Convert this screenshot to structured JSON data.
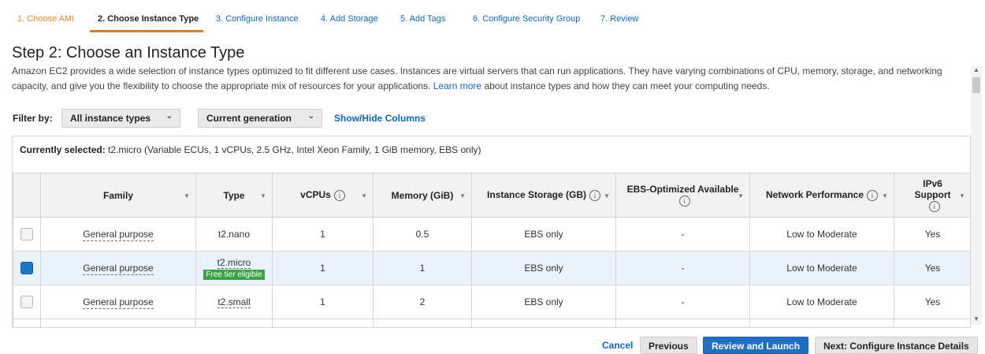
{
  "steps": [
    {
      "label": "1. Choose AMI"
    },
    {
      "label": "2. Choose Instance Type"
    },
    {
      "label": "3. Configure Instance"
    },
    {
      "label": "4. Add Storage"
    },
    {
      "label": "5. Add Tags"
    },
    {
      "label": "6. Configure Security Group"
    },
    {
      "label": "7. Review"
    }
  ],
  "page": {
    "title": "Step 2: Choose an Instance Type",
    "desc_before": "Amazon EC2 provides a wide selection of instance types optimized to fit different use cases. Instances are virtual servers that can run applications. They have varying combinations of CPU, memory, storage, and networking capacity, and give you the flexibility to choose the appropriate mix of resources for your applications. ",
    "learn_more": "Learn more",
    "desc_after": " about instance types and how they can meet your computing needs."
  },
  "filter": {
    "label": "Filter by:",
    "instance_types": "All instance types",
    "generation": "Current generation",
    "show_hide": "Show/Hide Columns"
  },
  "selection": {
    "label": "Currently selected:",
    "value": "t2.micro (Variable ECUs, 1 vCPUs, 2.5 GHz, Intel Xeon Family, 1 GiB memory, EBS only)"
  },
  "table": {
    "headers": {
      "family": "Family",
      "type": "Type",
      "vcpus": "vCPUs",
      "memory": "Memory (GiB)",
      "storage": "Instance Storage (GB)",
      "ebs": "EBS-Optimized Available",
      "network": "Network Performance",
      "ipv6_1": "IPv6",
      "ipv6_2": "Support"
    },
    "info_glyph": "i",
    "sort_glyph": "▼",
    "rows": [
      {
        "family": "General purpose",
        "type": "t2.nano",
        "vcpus": "1",
        "memory": "0.5",
        "storage": "EBS only",
        "ebs": "-",
        "network": "Low to Moderate",
        "ipv6": "Yes",
        "badge": ""
      },
      {
        "family": "General purpose",
        "type": "t2.micro",
        "vcpus": "1",
        "memory": "1",
        "storage": "EBS only",
        "ebs": "-",
        "network": "Low to Moderate",
        "ipv6": "Yes",
        "badge": "Free tier eligible"
      },
      {
        "family": "General purpose",
        "type": "t2.small",
        "vcpus": "1",
        "memory": "2",
        "storage": "EBS only",
        "ebs": "-",
        "network": "Low to Moderate",
        "ipv6": "Yes",
        "badge": ""
      }
    ]
  },
  "footer": {
    "cancel": "Cancel",
    "previous": "Previous",
    "review": "Review and Launch",
    "next": "Next: Configure Instance Details"
  },
  "colors": {
    "link": "#1166bb",
    "step_done": "#e0892f",
    "primary_button": "#1f6fc5",
    "badge": "#3aa346",
    "selected_row": "#eaf2fb"
  }
}
